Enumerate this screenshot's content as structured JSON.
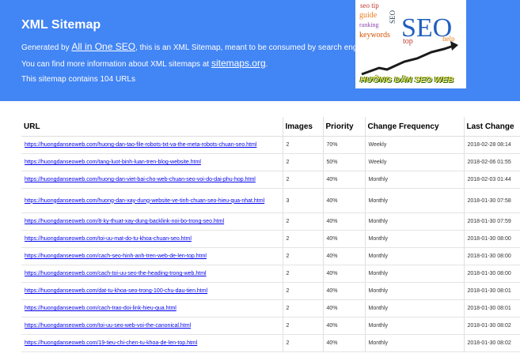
{
  "header": {
    "title": "XML Sitemap",
    "line1_prefix": "Generated by ",
    "line1_link": "All in One SEO",
    "line1_suffix": ", this is an XML Sitemap, meant to be consumed by search engines like Google or Bing.",
    "line2_prefix": "You can find more information about XML sitemaps at ",
    "line2_link": "sitemaps.org",
    "line2_suffix": ".",
    "line3": "This sitemap contains 104 URLs"
  },
  "logo": {
    "words": [
      "seo tip",
      "SEO",
      "guide",
      "ranking",
      "keywords",
      "top",
      "help",
      "SEO"
    ],
    "caption": "HƯỚNG DẪN SEO WEB"
  },
  "table": {
    "columns": [
      "URL",
      "Images",
      "Priority",
      "Change Frequency",
      "Last Change"
    ],
    "rows": [
      {
        "url": "https://huongdanseoweb.com/huong-dan-tao-file-robots-txt-va-the-meta-robots-chuan-seo.html",
        "images": "2",
        "priority": "70%",
        "freq": "Weekly",
        "last": "2018-02-28 08:14"
      },
      {
        "url": "https://huongdanseoweb.com/tang-luot-binh-luan-tren-blog-website.html",
        "images": "2",
        "priority": "50%",
        "freq": "Weekly",
        "last": "2018-02-06 01:55"
      },
      {
        "url": "https://huongdanseoweb.com/huong-dan-viet-bai-cho-web-chuan-seo-voi-do-dai-phu-hop.html",
        "images": "2",
        "priority": "40%",
        "freq": "Monthly",
        "last": "2018-02-03 01:44"
      },
      {
        "url": "https://huongdanseoweb.com/huong-dan-xay-dung-website-ve-tinh-chuan-seo-hieu-qua-nhat.html",
        "images": "3",
        "priority": "40%",
        "freq": "Monthly",
        "last": "2018-01-30 07:58"
      },
      {
        "url": "https://huongdanseoweb.com/8-ky-thuat-xay-dung-backlink-noi-bo-trong-seo.html",
        "images": "2",
        "priority": "40%",
        "freq": "Monthly",
        "last": "2018-01-30 07:59"
      },
      {
        "url": "https://huongdanseoweb.com/toi-uu-mat-do-tu-khoa-chuan-seo.html",
        "images": "2",
        "priority": "40%",
        "freq": "Monthly",
        "last": "2018-01-30 08:00"
      },
      {
        "url": "https://huongdanseoweb.com/cach-seo-hinh-anh-tren-web-de-len-top.html",
        "images": "2",
        "priority": "40%",
        "freq": "Monthly",
        "last": "2018-01-30 08:00"
      },
      {
        "url": "https://huongdanseoweb.com/cach-toi-uu-seo-the-heading-trong-web.html",
        "images": "2",
        "priority": "40%",
        "freq": "Monthly",
        "last": "2018-01-30 08:00"
      },
      {
        "url": "https://huongdanseoweb.com/dat-tu-khoa-seo-trong-100-chu-dau-tien.html",
        "images": "2",
        "priority": "40%",
        "freq": "Monthly",
        "last": "2018-01-30 08:01"
      },
      {
        "url": "https://huongdanseoweb.com/cach-trao-doi-link-hieu-qua.html",
        "images": "2",
        "priority": "40%",
        "freq": "Monthly",
        "last": "2018-01-30 08:01"
      },
      {
        "url": "https://huongdanseoweb.com/toi-uu-seo-web-voi-the-canonical.html",
        "images": "2",
        "priority": "40%",
        "freq": "Monthly",
        "last": "2018-01-30 08:02"
      },
      {
        "url": "https://huongdanseoweb.com/19-tieu-chi-chen-tu-khoa-de-len-top.html",
        "images": "2",
        "priority": "40%",
        "freq": "Monthly",
        "last": "2018-01-30 08:02"
      }
    ]
  },
  "colors": {
    "header_bg": "#4285f4",
    "link": "#0000ee"
  }
}
